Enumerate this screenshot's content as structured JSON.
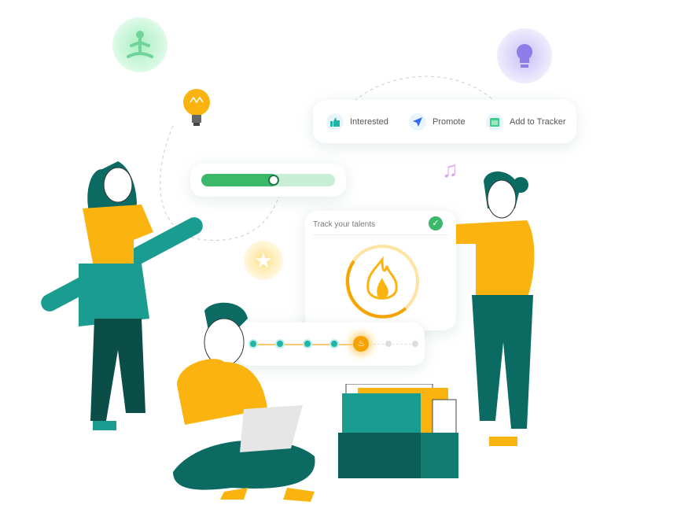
{
  "actions": [
    {
      "label": "Interested",
      "icon": "thumbs-up-icon",
      "color": "#1fb5a8"
    },
    {
      "label": "Promote",
      "icon": "send-icon",
      "color": "#2f6df6"
    },
    {
      "label": "Add to Tracker",
      "icon": "clipboard-icon",
      "color": "#3ecf8e"
    }
  ],
  "progress": {
    "value_percent": 57,
    "color": "#3cb86a",
    "track_color": "#c8efd6"
  },
  "tracker_card": {
    "title": "Track your talents",
    "status_icon": "check-circle-icon",
    "status_color": "#3cb86a"
  },
  "steps": {
    "completed": 4,
    "current": 5,
    "total": 7,
    "completed_color": "#1fb5a8",
    "current_color": "#f5a300",
    "pending_color": "#dddddd"
  },
  "colors": {
    "teal": "#1a9c91",
    "dark_teal": "#0b6b63",
    "yellow": "#fbb40f",
    "green_glow": "#bff2d2",
    "purple_glow": "#ddd8fb"
  }
}
